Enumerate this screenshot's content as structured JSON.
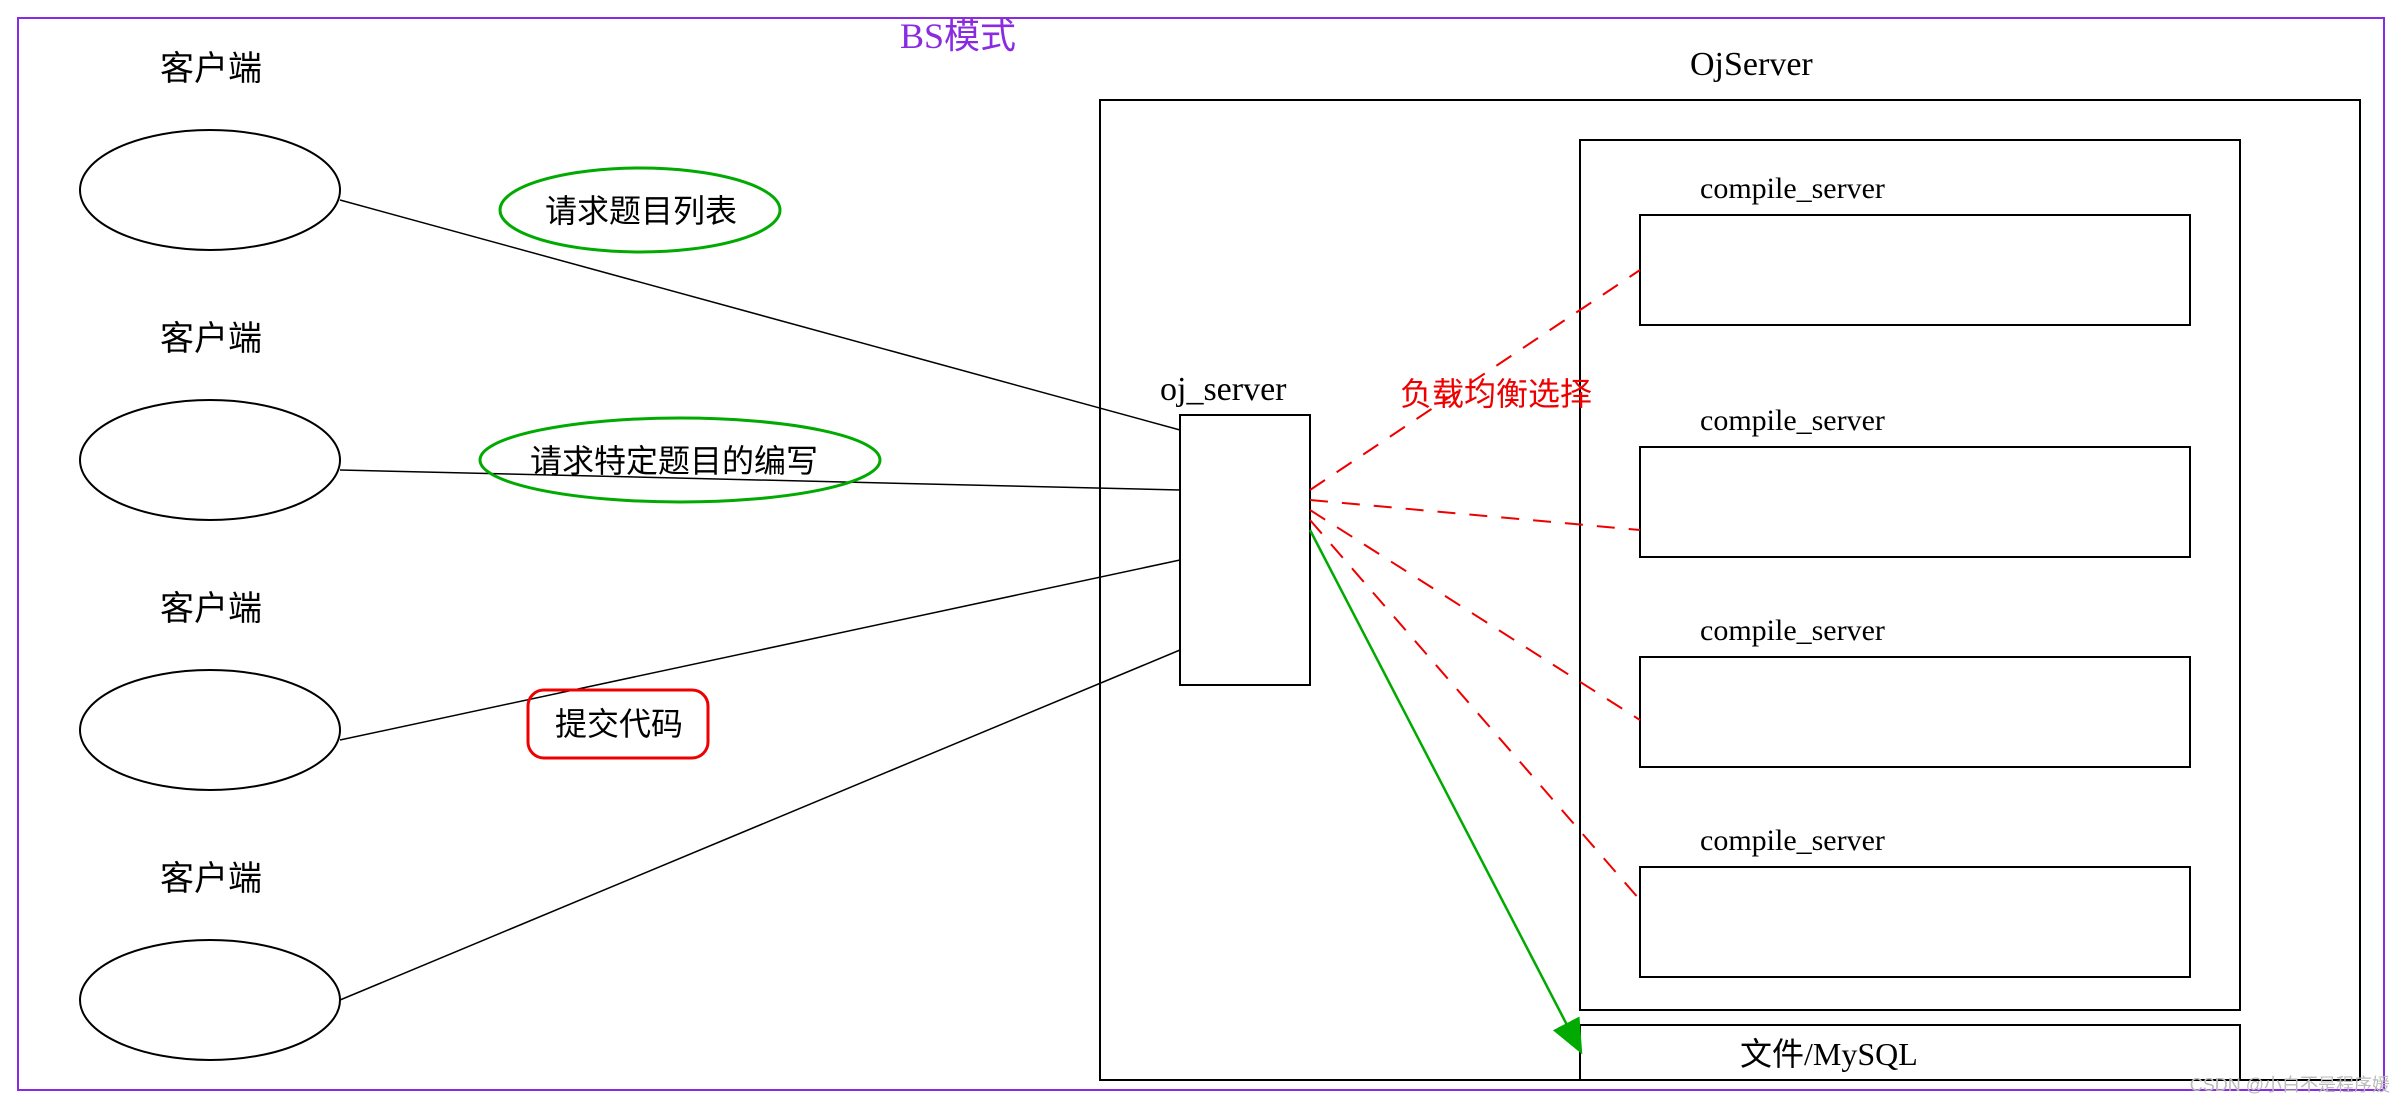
{
  "title": "BS模式",
  "clients": {
    "label": "客户端",
    "count": 4
  },
  "edgeLabels": {
    "reqList": "请求题目列表",
    "reqDetail": "请求特定题目的编写",
    "submit": "提交代码"
  },
  "center": {
    "label": "oj_server"
  },
  "lbLabel": "负载均衡选择",
  "serverGroup": {
    "title": "OjServer",
    "compileLabel": "compile_server",
    "compileCount": 4,
    "storageLabel": "文件/MySQL"
  },
  "watermark": "CSDN @小白不是程序媛"
}
